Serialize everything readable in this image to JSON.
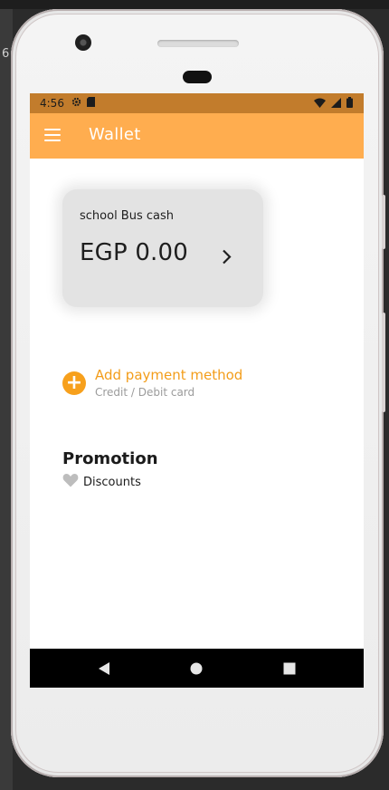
{
  "statusbar": {
    "time": "4:56",
    "icons": [
      "settings-icon",
      "sd-card-icon",
      "wifi-icon",
      "signal-icon",
      "battery-icon"
    ]
  },
  "appbar": {
    "title": "Wallet",
    "menu_icon": "hamburger-menu-icon"
  },
  "wallet_card": {
    "label": "school Bus cash",
    "amount": "EGP 0.00",
    "chevron": "chevron-right-icon"
  },
  "payment": {
    "title": "Add payment method",
    "subtitle": "Credit / Debit card",
    "icon": "+"
  },
  "promotion": {
    "heading": "Promotion",
    "item_label": "Discounts",
    "item_icon": "heart-icon"
  },
  "navbar": {
    "buttons": [
      "back-icon",
      "home-icon",
      "recents-icon"
    ]
  },
  "background": {
    "edge_text": "6"
  },
  "colors": {
    "status_bar": "#c27c2c",
    "app_bar": "#ffad4f",
    "accent": "#f7a01c",
    "card": "#e3e3e3"
  }
}
